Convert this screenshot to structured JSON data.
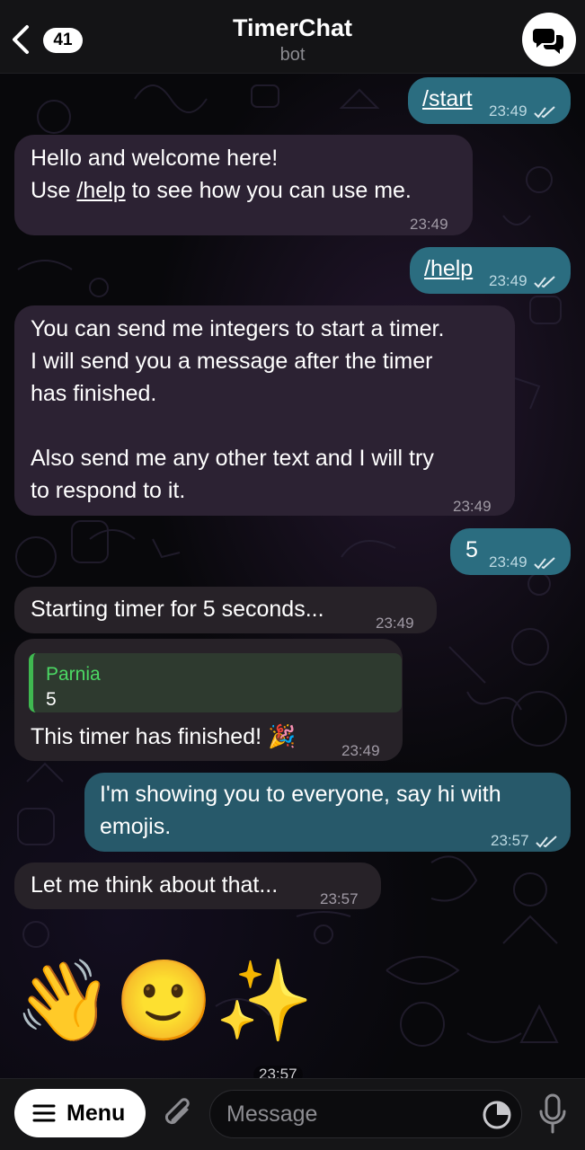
{
  "header": {
    "back_count": "41",
    "title": "TimerChat",
    "subtitle": "bot",
    "avatar_icon": "chat-bubbles-icon"
  },
  "messages": [
    {
      "dir": "out",
      "text": "/start",
      "time": "23:49",
      "status": "read"
    },
    {
      "dir": "in",
      "line1": "Hello and welcome here!",
      "line2_pre": "Use ",
      "line2_cmd": "/help",
      "line2_post": " to see how you can use me.",
      "time": "23:49"
    },
    {
      "dir": "out",
      "text": "/help",
      "time": "23:49",
      "status": "read"
    },
    {
      "dir": "in",
      "text": "You can send me integers to start a timer.\nI will send you a message after the timer\nhas finished.\n\nAlso send me any other text and I will try\nto respond to it.",
      "time": "23:49"
    },
    {
      "dir": "out",
      "text": "5",
      "time": "23:49",
      "status": "read"
    },
    {
      "dir": "in",
      "text": "Starting timer for 5 seconds...",
      "time": "23:49"
    },
    {
      "dir": "in",
      "reply_name": "Parnia",
      "reply_text": "5",
      "text": "This timer has finished! 🎉",
      "time": "23:49"
    },
    {
      "dir": "out",
      "text": "I'm showing you to everyone, say hi with\nemojis.",
      "time": "23:57",
      "status": "read"
    },
    {
      "dir": "in",
      "text": "Let me think about that...",
      "time": "23:57"
    }
  ],
  "emoji_message": {
    "emojis": "👋🙂✨",
    "time": "23:57"
  },
  "input_bar": {
    "menu_label": "Menu",
    "placeholder": "Message"
  },
  "colors": {
    "outgoing_bubble": "#2b6d80",
    "incoming_bubble": "#2c2233",
    "reply_accent": "#3fb950"
  }
}
